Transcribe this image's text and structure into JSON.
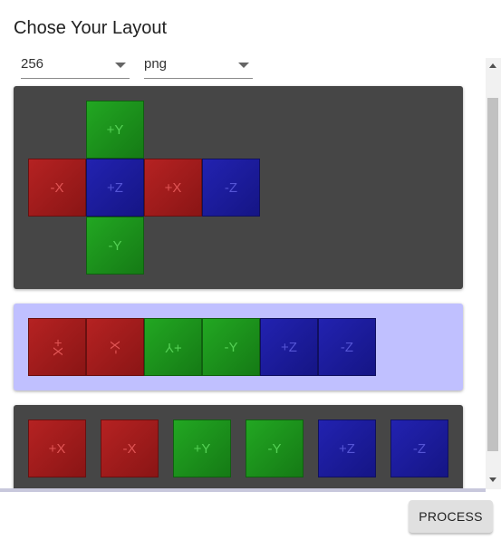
{
  "dialog": {
    "title": "Chose Your Layout",
    "size_select": {
      "value": "256"
    },
    "format_select": {
      "value": "png"
    },
    "process_label": "PROCESS"
  },
  "layouts": [
    {
      "name": "cross",
      "selected": false,
      "faces": [
        {
          "label": "+Y",
          "axis": "y"
        },
        {
          "label": "-X",
          "axis": "x"
        },
        {
          "label": "+Z",
          "axis": "z"
        },
        {
          "label": "+X",
          "axis": "x"
        },
        {
          "label": "-Z",
          "axis": "z"
        },
        {
          "label": "-Y",
          "axis": "y"
        }
      ]
    },
    {
      "name": "strip",
      "selected": true,
      "faces": [
        {
          "label": "+X",
          "axis": "x",
          "rotation": "90"
        },
        {
          "label": "-X",
          "axis": "x",
          "rotation": "-90"
        },
        {
          "label": "+Y",
          "axis": "y",
          "rotation": "180"
        },
        {
          "label": "-Y",
          "axis": "y"
        },
        {
          "label": "+Z",
          "axis": "z"
        },
        {
          "label": "-Z",
          "axis": "z"
        }
      ]
    },
    {
      "name": "separate",
      "selected": false,
      "faces": [
        {
          "label": "+X",
          "axis": "x"
        },
        {
          "label": "-X",
          "axis": "x"
        },
        {
          "label": "+Y",
          "axis": "y"
        },
        {
          "label": "-Y",
          "axis": "y"
        },
        {
          "label": "+Z",
          "axis": "z"
        },
        {
          "label": "-Z",
          "axis": "z"
        }
      ]
    }
  ],
  "colors": {
    "card_dark": "#464646",
    "card_selected": "#c0c0ff",
    "x_face": "#b52222",
    "y_face": "#22a722",
    "z_face": "#2222b0"
  }
}
